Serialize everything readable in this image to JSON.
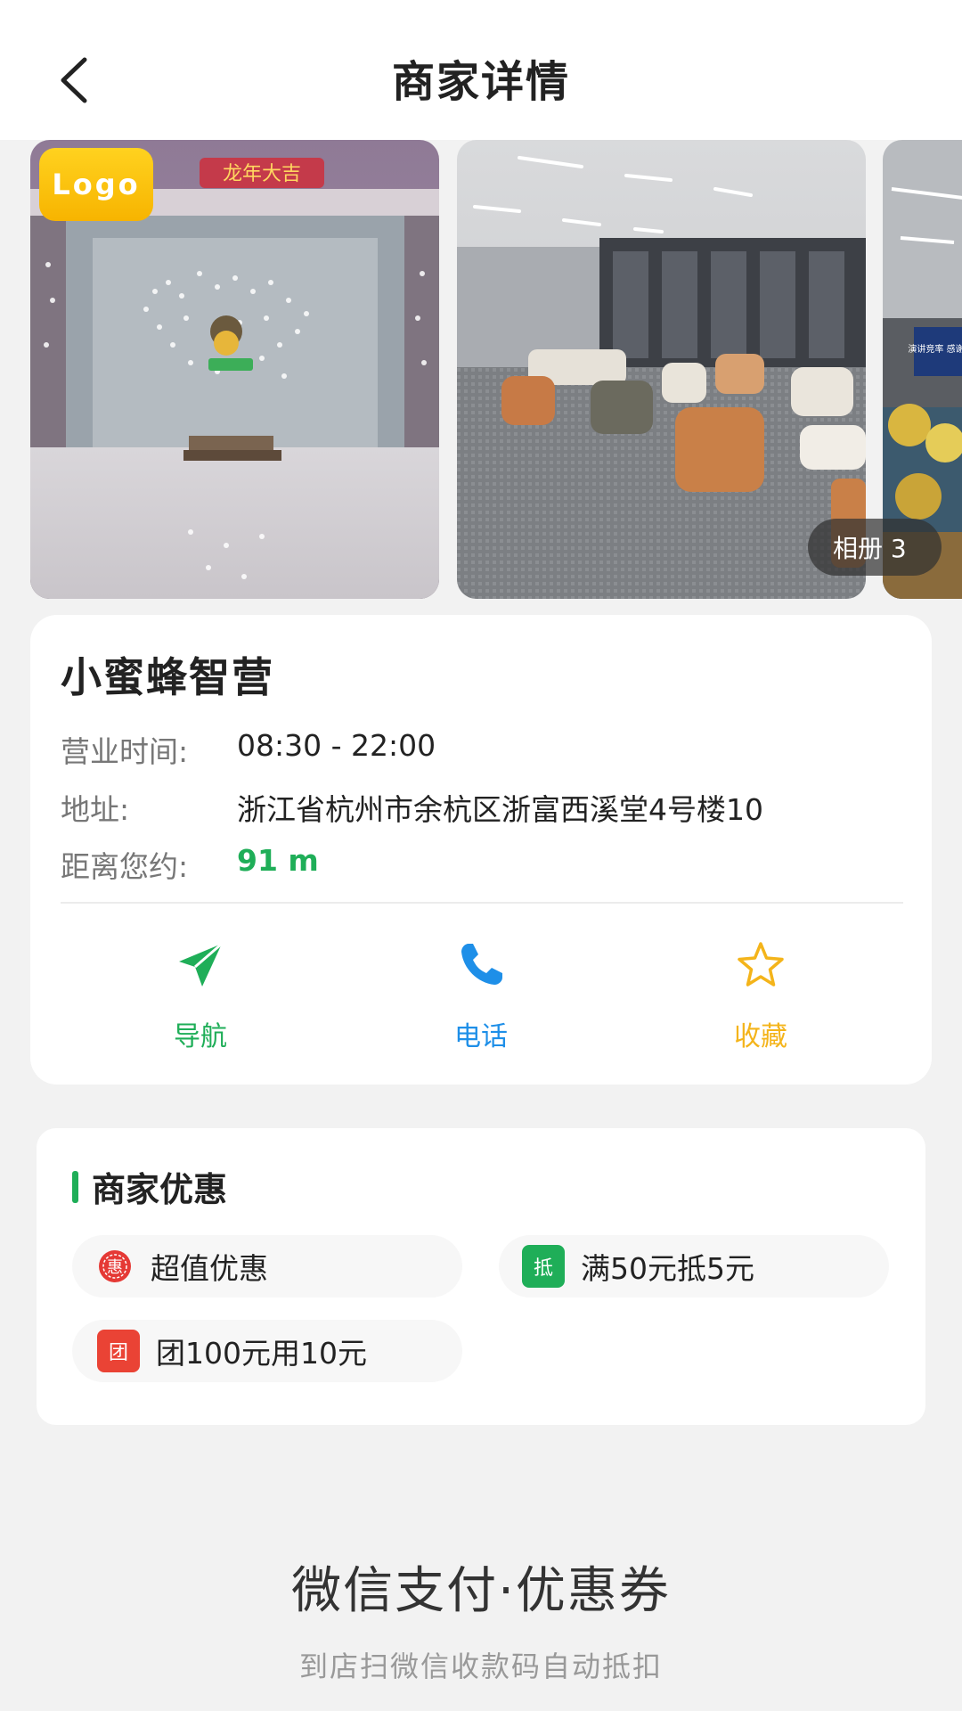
{
  "header": {
    "title": "商家详情"
  },
  "gallery": {
    "logo_badge": "Logo",
    "album_label": "相册 3",
    "sign_text": "龙年大吉",
    "tv_text": "演讲竞率 感谢收看"
  },
  "store": {
    "name": "小蜜蜂智营",
    "hours_label": "营业时间:",
    "hours_value": "08:30 - 22:00",
    "address_label": "地址:",
    "address_value": "浙江省杭州市余杭区浙富西溪堂4号楼10",
    "distance_label": "距离您约:",
    "distance_value": "91 m"
  },
  "actions": [
    {
      "label": "导航",
      "icon": "navigation-icon",
      "color": "#1fae58"
    },
    {
      "label": "电话",
      "icon": "phone-icon",
      "color": "#1e8fe8"
    },
    {
      "label": "收藏",
      "icon": "star-icon",
      "color": "#f4b41a"
    }
  ],
  "promotions": {
    "title": "商家优惠",
    "items": [
      {
        "icon_text": "惠",
        "label": "超值优惠",
        "color": "#e53935"
      },
      {
        "icon_text": "抵",
        "label": "满50元抵5元",
        "color": "#1fae58"
      },
      {
        "icon_text": "团",
        "label": "团100元用10元",
        "color": "#ea4335"
      }
    ]
  },
  "payment": {
    "title": "微信支付·优惠券",
    "subtitle": "到店扫微信收款码自动抵扣"
  }
}
